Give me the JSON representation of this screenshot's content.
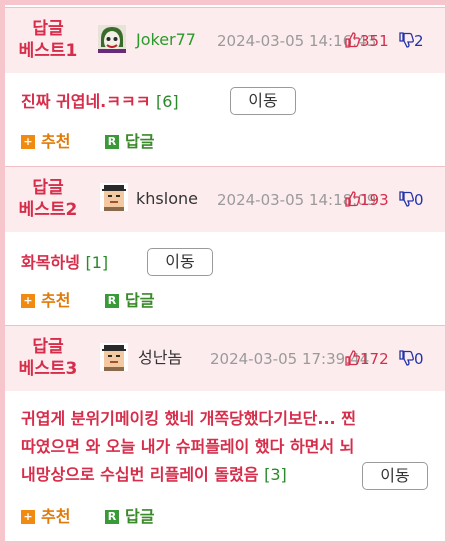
{
  "comments": [
    {
      "rank_line1": "답글",
      "rank_line2": "베스트1",
      "nickname": "Joker77",
      "nickname_color": "#2a9a2a",
      "timestamp": "2024-03-05 14:16:43",
      "likes": "351",
      "dislikes": "2",
      "text": "진짜 귀엽네.ㅋㅋㅋ",
      "reply_count": "[6]",
      "move_label": "이동",
      "recommend_label": "추천",
      "reply_label": "답글",
      "avatar_icon": "joker-avatar-icon"
    },
    {
      "rank_line1": "답글",
      "rank_line2": "베스트2",
      "nickname": "khslone",
      "nickname_color": "#333333",
      "timestamp": "2024-03-05 14:18:09",
      "likes": "193",
      "dislikes": "0",
      "text": "화목하넹",
      "reply_count": "[1]",
      "move_label": "이동",
      "recommend_label": "추천",
      "reply_label": "답글",
      "avatar_icon": "pixel-face-avatar-icon"
    },
    {
      "rank_line1": "답글",
      "rank_line2": "베스트3",
      "nickname": "성난놈",
      "nickname_color": "#333333",
      "timestamp": "2024-03-05 17:39:44",
      "likes": "172",
      "dislikes": "0",
      "text_line1": "귀엽게 분위기메이킹 했네 개쪽당했다기보단... 찐",
      "text_line2": "따였으면 와 오늘 내가 슈퍼플레이 했다 하면서 뇌",
      "text_line3": "내망상으로 수십번 리플레이 돌렸음",
      "reply_count": "[3]",
      "move_label": "이동",
      "recommend_label": "추천",
      "reply_label": "답글",
      "avatar_icon": "pixel-face-avatar-icon"
    }
  ],
  "colors": {
    "accent": "#d62d4a",
    "header_bg": "#fdecee",
    "border": "#f7c6cc",
    "recommend": "#e07a0a",
    "reply": "#3a8a2a",
    "dislike": "#2233aa"
  }
}
